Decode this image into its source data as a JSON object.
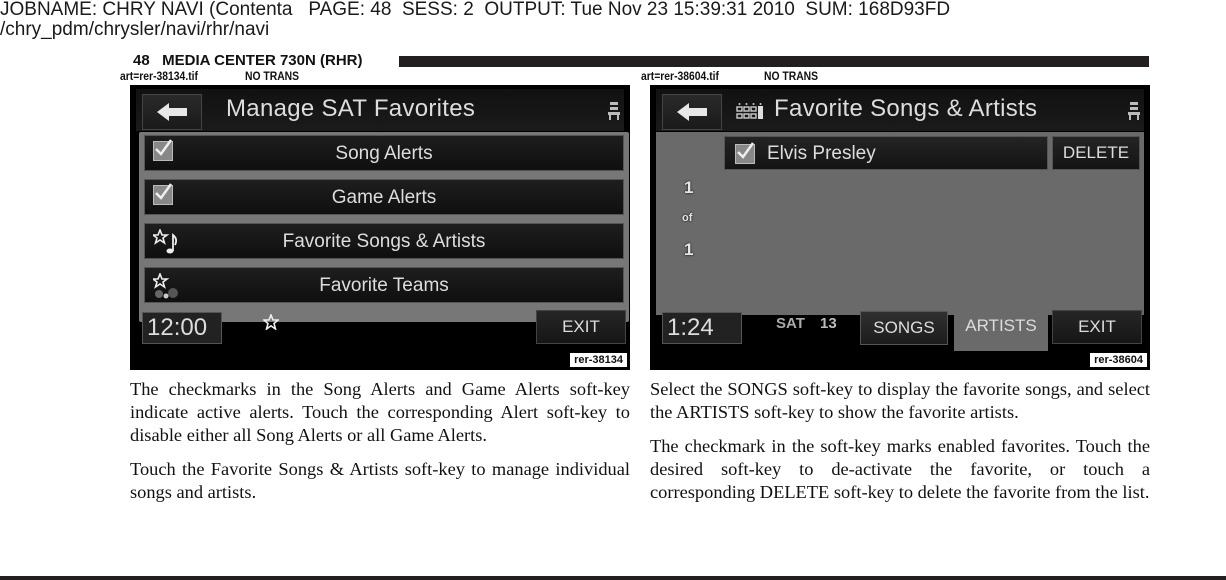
{
  "job_header": {
    "line1": "JOBNAME: CHRY NAVI (Contenta   PAGE: 48  SESS: 2  OUTPUT: Tue Nov 23 15:39:31 2010  SUM: 168D93FD",
    "line2": "/chry_pdm/chrysler/navi/rhr/navi"
  },
  "running_head": "48   MEDIA CENTER 730N (RHR)",
  "figures": [
    {
      "art_file": "art=rer-38134.tif",
      "art_note": "NO TRANS",
      "tag": "rer-38134",
      "screen": {
        "title": "Manage SAT Favorites",
        "menu_items": [
          {
            "label": "Song Alerts",
            "icon": "checkbox-checked-icon"
          },
          {
            "label": "Game Alerts",
            "icon": "checkbox-checked-icon"
          },
          {
            "label": "Favorite Songs & Artists",
            "icon": "star-music-note-icon"
          },
          {
            "label": "Favorite Teams",
            "icon": "star-balls-icon"
          }
        ],
        "clock": "12:00",
        "exit_label": "EXIT"
      }
    },
    {
      "art_file": "art=rer-38604.tif",
      "art_note": "NO TRANS",
      "tag": "rer-38604",
      "screen": {
        "title": "Favorite Songs & Artists",
        "list_items": [
          {
            "label": "Elvis Presley",
            "checked": true
          }
        ],
        "delete_label": "DELETE",
        "pager": {
          "current": "1",
          "of": "of",
          "total": "1"
        },
        "clock": "1:24",
        "source": "SAT",
        "channel": "13",
        "tabs": [
          "SONGS",
          "ARTISTS"
        ],
        "active_tab": "ARTISTS",
        "exit_label": "EXIT"
      }
    }
  ],
  "body_text": {
    "left": [
      "The checkmarks in the Song Alerts and Game Alerts soft-key indicate active alerts. Touch the corresponding Alert soft-key to disable either all Song Alerts or all Game Alerts.",
      "Touch the Favorite Songs & Artists soft-key to manage individual songs and artists."
    ],
    "right": [
      "Select the SONGS soft-key to display the favorite songs, and select the ARTISTS soft-key to show the favorite artists.",
      "The checkmark in the soft-key marks enabled favorites. Touch the desired soft-key to de-activate the favorite, or touch a corresponding DELETE soft-key to delete the favorite from the list."
    ]
  },
  "colors": {
    "screen_bg": "#000000",
    "content_gray": "#6a6a6a",
    "menu_frame": "#777777",
    "rule_black": "#231f20"
  }
}
